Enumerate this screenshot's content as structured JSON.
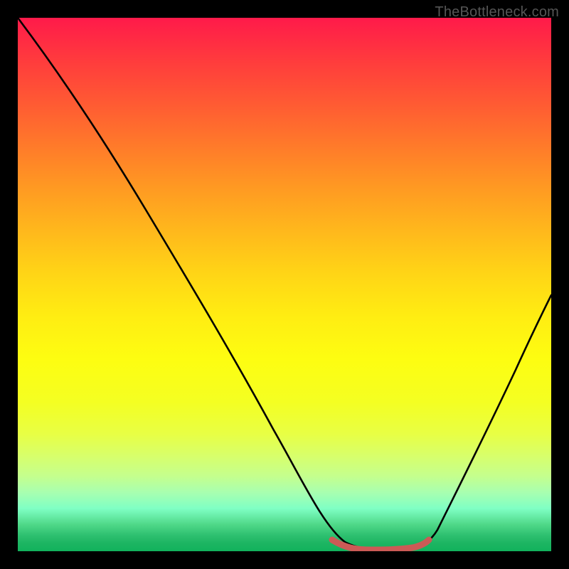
{
  "watermark": {
    "text": "TheBottleneck.com"
  },
  "chart_data": {
    "type": "line",
    "title": "",
    "xlabel": "",
    "ylabel": "",
    "xlim": [
      0,
      100
    ],
    "ylim": [
      0,
      100
    ],
    "series": [
      {
        "name": "black-curve",
        "x": [
          0,
          10,
          20,
          30,
          40,
          50,
          55,
          60,
          65,
          70,
          75,
          80,
          85,
          90,
          95,
          100
        ],
        "values": [
          100,
          85,
          70,
          55,
          41,
          27,
          19,
          11,
          4,
          0,
          0,
          5,
          13,
          23,
          34,
          46
        ]
      },
      {
        "name": "red-segment",
        "x": [
          59,
          62,
          65,
          68,
          71,
          74,
          77
        ],
        "values": [
          1.6,
          0.9,
          0.5,
          0.4,
          0.5,
          0.9,
          1.6
        ]
      }
    ],
    "colors": {
      "gradient_top": "#ff1a4a",
      "gradient_mid": "#ffed12",
      "gradient_bottom": "#12b25c",
      "curve": "#000000",
      "segment": "#cc5a56",
      "background": "#000000"
    }
  }
}
